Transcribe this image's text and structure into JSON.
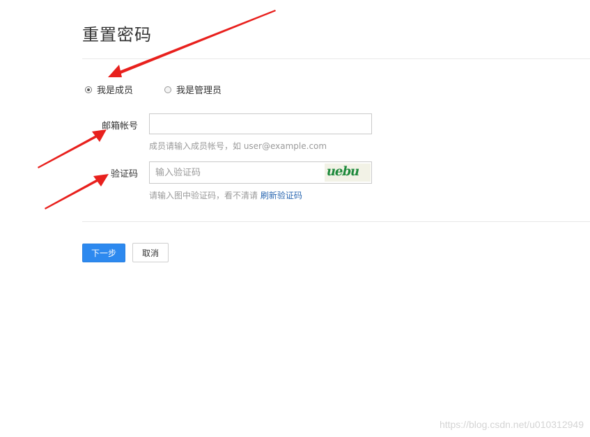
{
  "page": {
    "title": "重置密码"
  },
  "role": {
    "options": [
      {
        "label": "我是成员",
        "checked": true
      },
      {
        "label": "我是管理员",
        "checked": false
      }
    ]
  },
  "email": {
    "label": "邮箱帐号",
    "value": "",
    "hint": "成员请输入成员帐号，如 user@example.com"
  },
  "captcha": {
    "label": "验证码",
    "placeholder": "输入验证码",
    "value": "",
    "image_text": "uebu",
    "hint": "请输入图中验证码，看不清请",
    "refresh_link": "刷新验证码"
  },
  "actions": {
    "next_label": "下一步",
    "cancel_label": "取消"
  },
  "watermark": "https://blog.csdn.net/u010312949",
  "colors": {
    "primary": "#2d89ef",
    "link": "#2a67b1",
    "arrow": "#e8201d",
    "captcha_text": "#1e8a3c"
  }
}
